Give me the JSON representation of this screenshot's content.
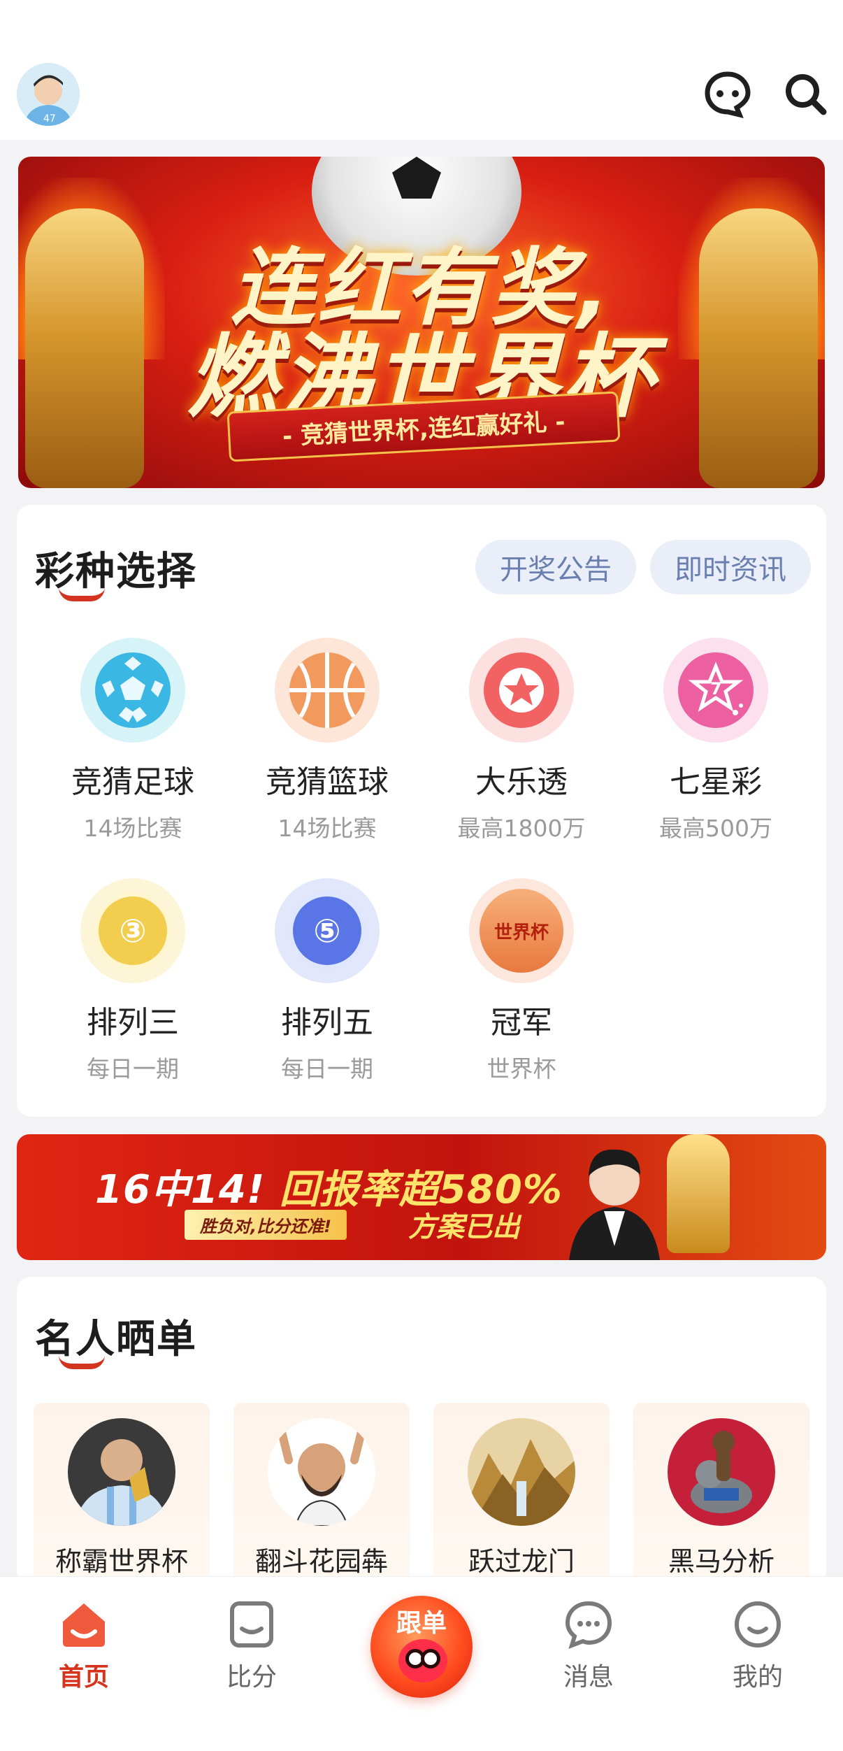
{
  "banner_top": {
    "line1": "连红有奖,",
    "line2": "燃沸世界杯",
    "ribbon": "- 竞猜世界杯,连红赢好礼 -"
  },
  "lottery": {
    "title": "彩种选择",
    "pills": [
      "开奖公告",
      "即时资讯"
    ],
    "games": [
      {
        "name": "竞猜足球",
        "sub": "14场比赛",
        "icon": "soccer-icon"
      },
      {
        "name": "竞猜篮球",
        "sub": "14场比赛",
        "icon": "basketball-icon"
      },
      {
        "name": "大乐透",
        "sub": "最高1800万",
        "icon": "star-ball-icon"
      },
      {
        "name": "七星彩",
        "sub": "最高500万",
        "icon": "seven-star-icon"
      },
      {
        "name": "排列三",
        "sub": "每日一期",
        "icon": "ball-3-icon",
        "glyph": "③"
      },
      {
        "name": "排列五",
        "sub": "每日一期",
        "icon": "ball-5-icon",
        "glyph": "⑤"
      },
      {
        "name": "冠军",
        "sub": "世界杯",
        "icon": "champion-icon",
        "glyph": "世界杯"
      }
    ]
  },
  "banner_mid": {
    "headline_a": "16中14!",
    "headline_b": "回报率超580%",
    "tagline": "胜负对,比分还准!",
    "plan": "方案已出"
  },
  "celebrities": {
    "title": "名人晒单",
    "items": [
      {
        "name": "称霸世界杯"
      },
      {
        "name": "翻斗花园犇"
      },
      {
        "name": "跃过龙门"
      },
      {
        "name": "黑马分析"
      }
    ]
  },
  "tabbar": {
    "home": "首页",
    "score": "比分",
    "follow": "跟单",
    "messages": "消息",
    "mine": "我的"
  },
  "colors": {
    "accent": "#d6331d",
    "pill_bg": "#eaeef8",
    "pill_text": "#6a7fb0"
  }
}
